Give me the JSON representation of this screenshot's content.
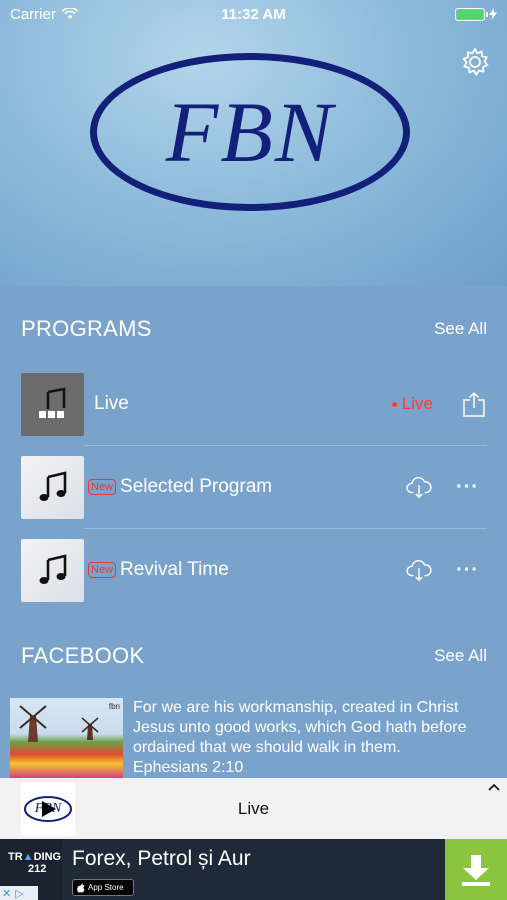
{
  "status_bar": {
    "carrier": "Carrier",
    "time": "11:32 AM"
  },
  "header": {
    "logo_text": "FBN"
  },
  "programs": {
    "title": "PROGRAMS",
    "see_all": "See All",
    "items": [
      {
        "label": "Live",
        "live_label": "Live",
        "new_badge": ""
      },
      {
        "label": "Selected Program",
        "new_badge": "New"
      },
      {
        "label": "Revival Time",
        "new_badge": "New"
      }
    ]
  },
  "facebook": {
    "title": "FACEBOOK",
    "see_all": "See All",
    "post_text": "For we are his workmanship, created in Christ Jesus unto good works, which God hath before ordained that we should walk in them.",
    "post_ref": "Ephesians 2:10",
    "image_caption": "fbn"
  },
  "player": {
    "title": "Live",
    "logo_text": "FBN"
  },
  "ad": {
    "brand_top": "TR",
    "brand_mid": "DING",
    "brand_num": "212",
    "title": "Forex, Petrol și Aur",
    "store_small": "Download on the",
    "store_label": "App Store"
  },
  "colors": {
    "background": "#7aa3cc",
    "logo": "#13207a",
    "live": "#ff3b30",
    "download": "#8bc53f"
  }
}
